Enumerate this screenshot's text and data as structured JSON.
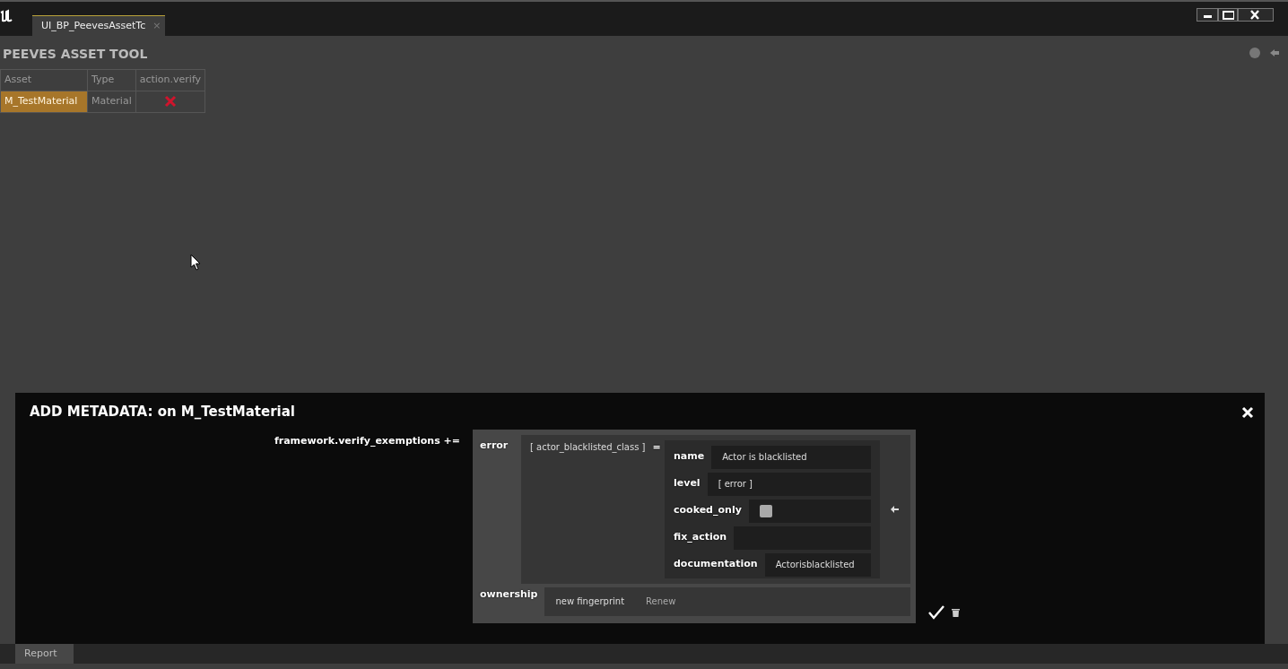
{
  "window": {
    "tab": "UI_BP_PeevesAssetTc",
    "tab_close": "×"
  },
  "tool": {
    "title": "PEEVES ASSET TOOL",
    "columns": [
      "Asset",
      "Type",
      "action.verify"
    ],
    "rows": [
      {
        "asset": "M_TestMaterial",
        "type": "Material",
        "verified": false
      }
    ],
    "report_button": "Report"
  },
  "dialog": {
    "title": "ADD METADATA: on M_TestMaterial",
    "property": "framework.verify_exemptions +=",
    "error_label": "error",
    "key": "[ actor_blacklisted_class ]",
    "equals": "=",
    "fields": [
      {
        "kind": "text",
        "label": "name",
        "value": "Actor is blacklisted"
      },
      {
        "kind": "text",
        "label": "level",
        "value": "[ error ]"
      },
      {
        "kind": "checkbox",
        "label": "cooked_only",
        "checked": false
      },
      {
        "kind": "text",
        "label": "fix_action"
      },
      {
        "kind": "text",
        "label": "documentation",
        "value": "Actorisblacklisted"
      }
    ],
    "ownership_label": "ownership",
    "fingerprint": "new fingerprint",
    "renew": "Renew"
  }
}
